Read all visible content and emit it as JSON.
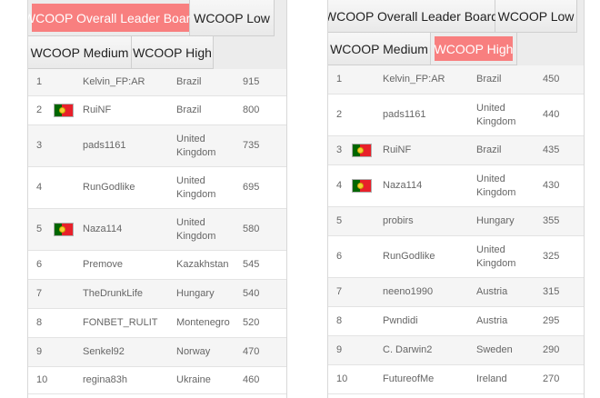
{
  "left_panel": {
    "tabs": [
      {
        "label": "WCOOP Overall Leader Board",
        "active": true
      },
      {
        "label": "WCOOP Low",
        "active": false
      },
      {
        "label": "WCOOP Medium",
        "active": false
      },
      {
        "label": "WCOOP High",
        "active": false
      }
    ],
    "rows": [
      {
        "rank": "1",
        "flag": "",
        "name": "Kelvin_FP:AR",
        "country": "Brazil",
        "score": "915"
      },
      {
        "rank": "2",
        "flag": "portugal-flag-icon",
        "name": "RuiNF",
        "country": "Brazil",
        "score": "800"
      },
      {
        "rank": "3",
        "flag": "",
        "name": "pads1161",
        "country": "United Kingdom",
        "score": "735"
      },
      {
        "rank": "4",
        "flag": "",
        "name": "RunGodlike",
        "country": "United Kingdom",
        "score": "695"
      },
      {
        "rank": "5",
        "flag": "portugal-flag-icon",
        "name": "Naza114",
        "country": "United Kingdom",
        "score": "580"
      },
      {
        "rank": "6",
        "flag": "",
        "name": "Premove",
        "country": "Kazakhstan",
        "score": "545"
      },
      {
        "rank": "7",
        "flag": "",
        "name": "TheDrunkLife",
        "country": "Hungary",
        "score": "540"
      },
      {
        "rank": "8",
        "flag": "",
        "name": "FONBET_RULIT",
        "country": "Montenegro",
        "score": "520"
      },
      {
        "rank": "9",
        "flag": "",
        "name": "Senkel92",
        "country": "Norway",
        "score": "470"
      },
      {
        "rank": "10",
        "flag": "",
        "name": "regina83h",
        "country": "Ukraine",
        "score": "460"
      }
    ]
  },
  "right_panel": {
    "tabs": [
      {
        "label": "WCOOP Overall Leader Board",
        "active": false
      },
      {
        "label": "WCOOP Low",
        "active": false
      },
      {
        "label": "WCOOP Medium",
        "active": false
      },
      {
        "label": "WCOOP High",
        "active": true
      }
    ],
    "rows": [
      {
        "rank": "1",
        "flag": "",
        "name": "Kelvin_FP:AR",
        "country": "Brazil",
        "score": "450"
      },
      {
        "rank": "2",
        "flag": "",
        "name": "pads1161",
        "country": "United Kingdom",
        "score": "440"
      },
      {
        "rank": "3",
        "flag": "portugal-flag-icon",
        "name": "RuiNF",
        "country": "Brazil",
        "score": "435"
      },
      {
        "rank": "4",
        "flag": "portugal-flag-icon",
        "name": "Naza114",
        "country": "United Kingdom",
        "score": "430"
      },
      {
        "rank": "5",
        "flag": "",
        "name": "probirs",
        "country": "Hungary",
        "score": "355"
      },
      {
        "rank": "6",
        "flag": "",
        "name": "RunGodlike",
        "country": "United Kingdom",
        "score": "325"
      },
      {
        "rank": "7",
        "flag": "",
        "name": "neeno1990",
        "country": "Austria",
        "score": "315"
      },
      {
        "rank": "8",
        "flag": "",
        "name": "Pwndidi",
        "country": "Austria",
        "score": "295"
      },
      {
        "rank": "9",
        "flag": "",
        "name": "C. Darwin2",
        "country": "Sweden",
        "score": "290"
      },
      {
        "rank": "10",
        "flag": "",
        "name": "FutureofMe",
        "country": "Ireland",
        "score": "270"
      }
    ]
  },
  "colors": {
    "active_tab": "#f87f7f",
    "flag_green": "#006600",
    "flag_red": "#e8202a"
  }
}
